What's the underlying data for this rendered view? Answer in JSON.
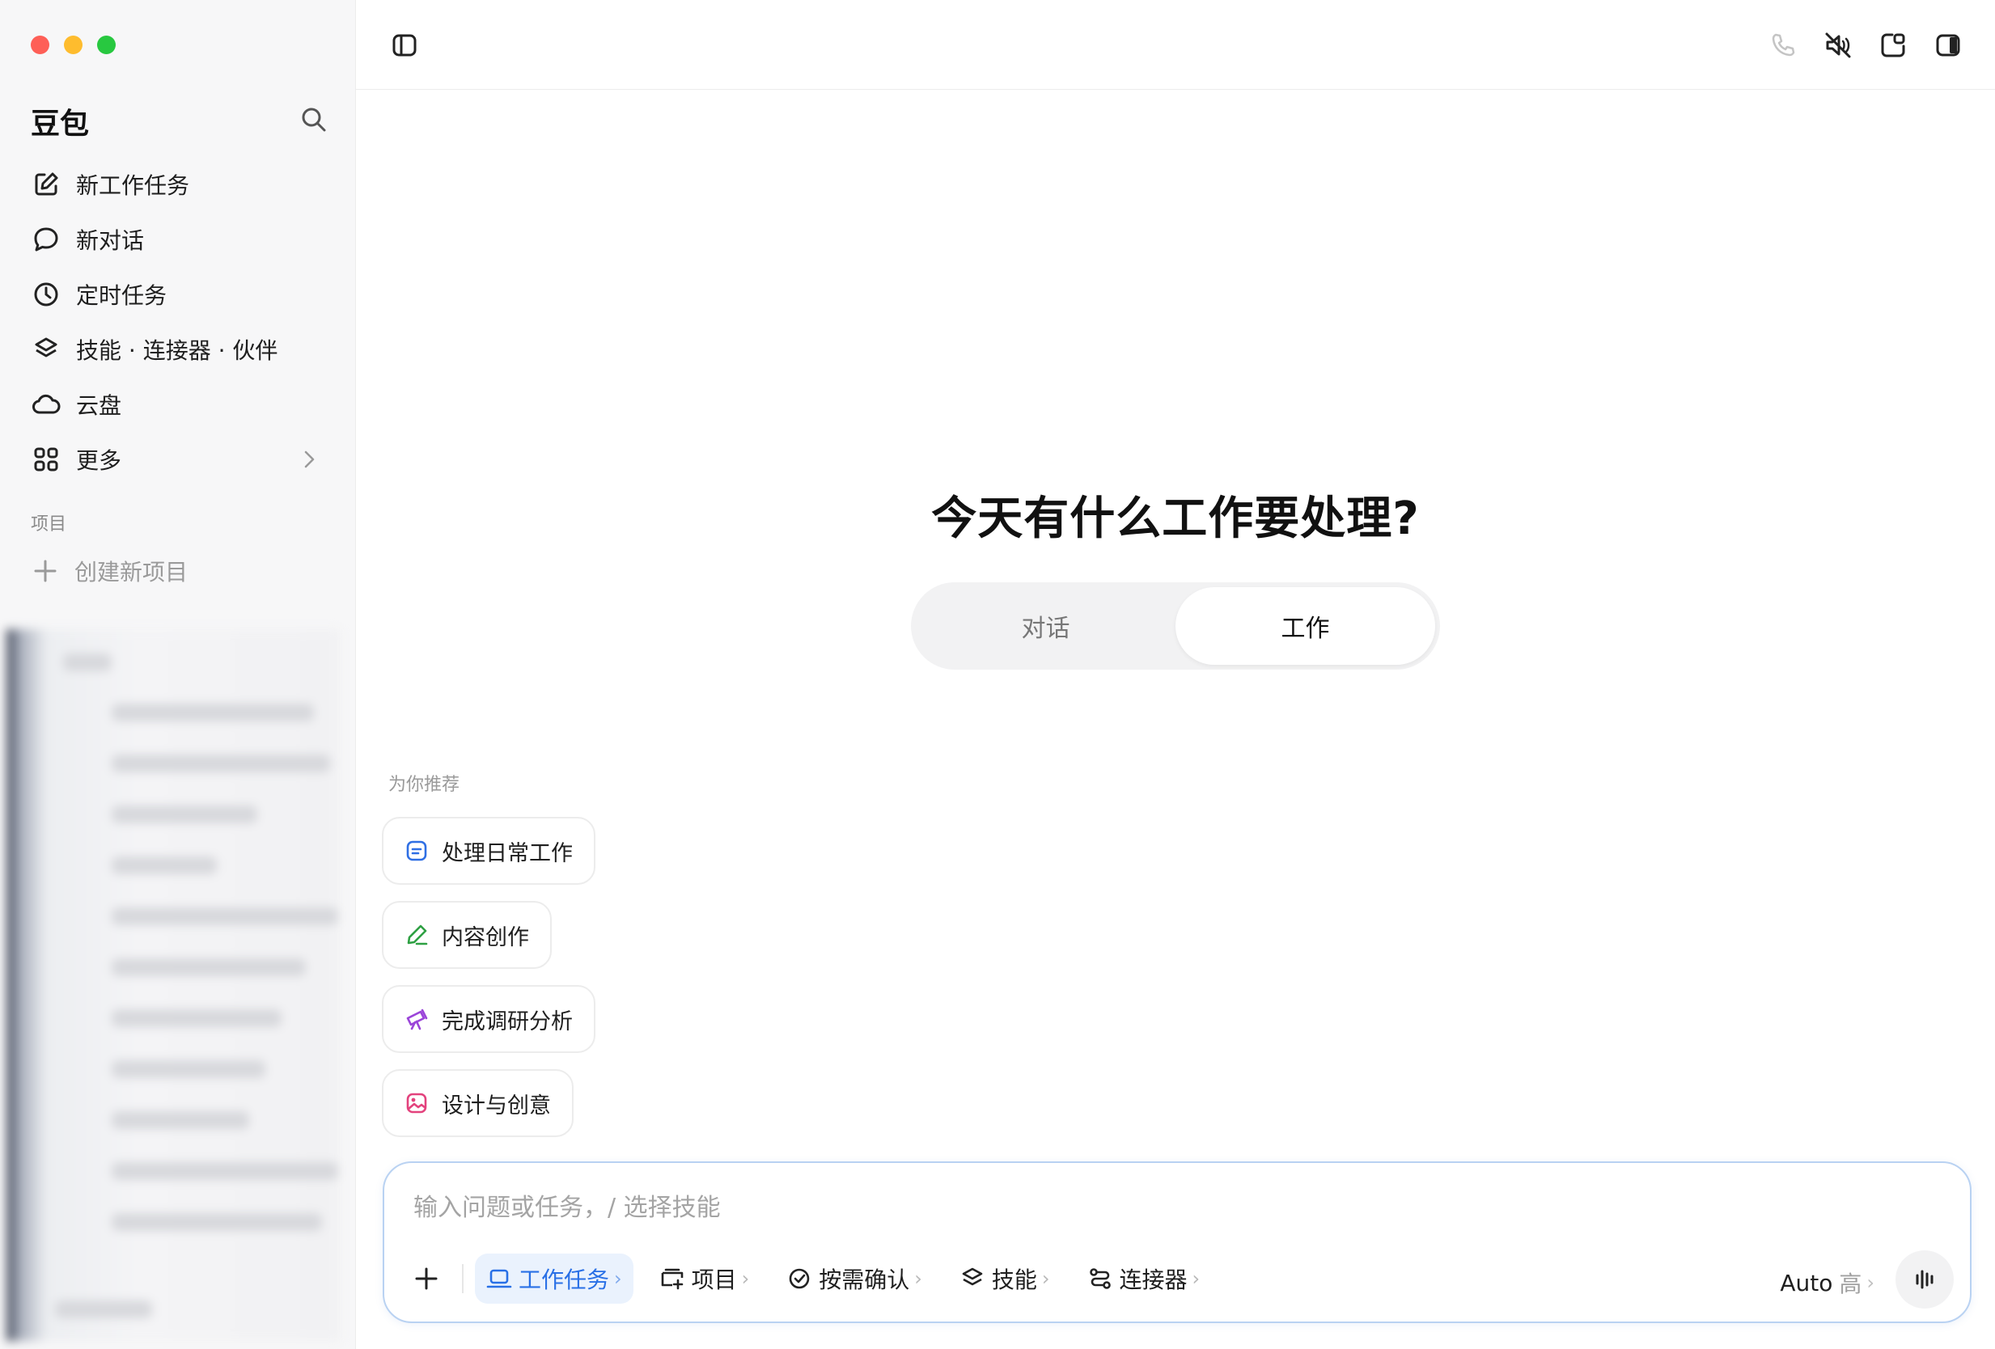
{
  "sidebar": {
    "title": "豆包",
    "nav": [
      {
        "label": "新工作任务"
      },
      {
        "label": "新对话"
      },
      {
        "label": "定时任务"
      },
      {
        "label": "技能 · 连接器 · 伙伴"
      },
      {
        "label": "云盘"
      },
      {
        "label": "更多"
      }
    ],
    "section_label": "项目",
    "create_project": "创建新项目"
  },
  "main": {
    "headline": "今天有什么工作要处理?",
    "mode_tabs": [
      {
        "label": "对话",
        "active": false
      },
      {
        "label": "工作",
        "active": true
      }
    ],
    "recommend_label": "为你推荐",
    "recommendations": [
      {
        "label": "处理日常工作",
        "icon": "document-icon",
        "color": "#2f6fe4"
      },
      {
        "label": "内容创作",
        "icon": "pencil-icon",
        "color": "#2ea043"
      },
      {
        "label": "完成调研分析",
        "icon": "telescope-icon",
        "color": "#9b45d9"
      },
      {
        "label": "设计与创意",
        "icon": "image-icon",
        "color": "#e3427d"
      }
    ]
  },
  "composer": {
    "placeholder": "输入问题或任务，/ 选择技能",
    "tools": [
      {
        "label": "工作任务",
        "icon": "laptop-icon",
        "active": true
      },
      {
        "label": "项目",
        "icon": "folder-plus-icon",
        "active": false
      },
      {
        "label": "按需确认",
        "icon": "check-circle-icon",
        "active": false
      },
      {
        "label": "技能",
        "icon": "layers-icon",
        "active": false
      },
      {
        "label": "连接器",
        "icon": "connector-icon",
        "active": false
      }
    ],
    "arrow": "›",
    "model": "Auto",
    "model_level": "高"
  },
  "colors": {
    "accent": "#2970e6",
    "composer_border": "#b9d2f2"
  }
}
